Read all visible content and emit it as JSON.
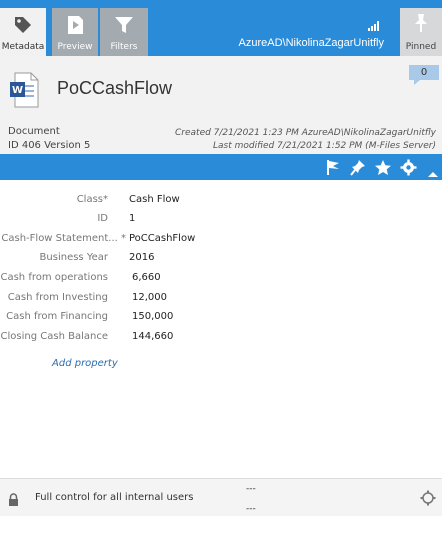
{
  "tabs": [
    {
      "label": "Metadata",
      "icon": "tag-icon"
    },
    {
      "label": "Preview",
      "icon": "play-icon"
    },
    {
      "label": "Filters",
      "icon": "filter-icon"
    }
  ],
  "topbar": {
    "user": "AzureAD\\NikolinaZagarUnitfly",
    "pinned_label": "Pinned",
    "accent": "#2a8bd8"
  },
  "document": {
    "title": "PoCCashFlow",
    "badge_count": "0",
    "type": "Document",
    "id_version": "ID 406  Version 5",
    "created": "Created 7/21/2021 1:23 PM AzureAD\\NikolinaZagarUnitfly",
    "modified": "Last modified 7/21/2021 1:52 PM (M-Files Server)"
  },
  "properties": [
    {
      "key": "Class*",
      "value": "Cash Flow"
    },
    {
      "key": "ID",
      "value": "1"
    },
    {
      "key": "Cash-Flow Statement... *",
      "value": "PoCCashFlow"
    },
    {
      "key": "Business Year",
      "value": "2016"
    },
    {
      "key": "Cash from operations",
      "value": "6,660"
    },
    {
      "key": "Cash from Investing",
      "value": "12,000"
    },
    {
      "key": "Cash from Financing",
      "value": "150,000"
    },
    {
      "key": "Closing Cash Balance",
      "value": "144,660"
    }
  ],
  "add_property": "Add property",
  "footer": {
    "permissions": "Full control for all internal users",
    "dash_top": "---",
    "dash_bottom": "---"
  }
}
